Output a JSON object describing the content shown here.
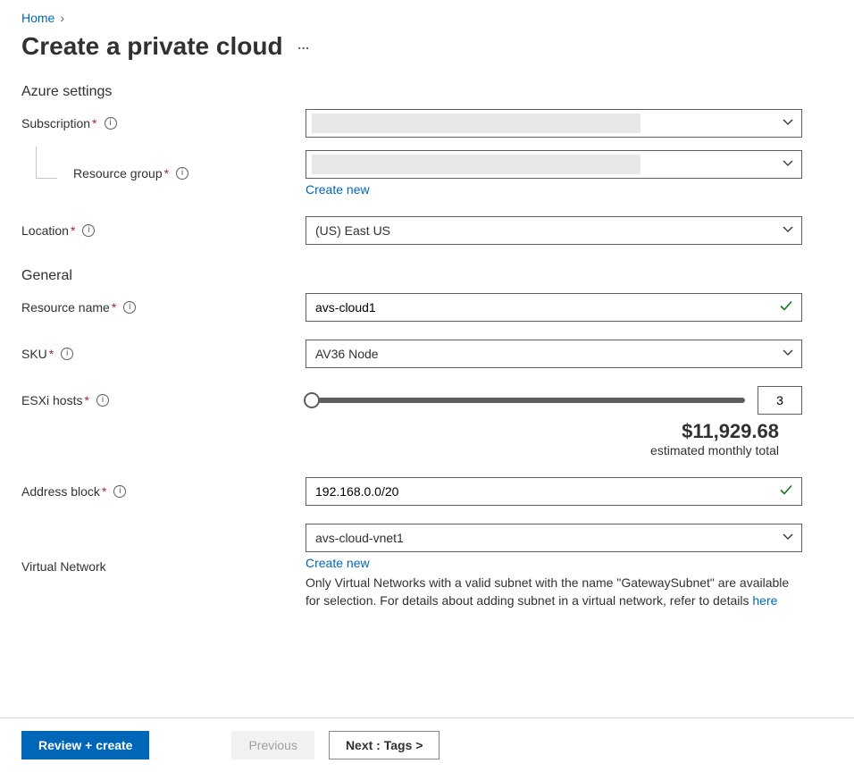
{
  "breadcrumb": {
    "home": "Home"
  },
  "title": "Create a private cloud",
  "sections": {
    "azure": "Azure settings",
    "general": "General"
  },
  "fields": {
    "subscription": {
      "label": "Subscription",
      "value": ""
    },
    "resource_group": {
      "label": "Resource group",
      "value": "",
      "create_new": "Create new"
    },
    "location": {
      "label": "Location",
      "value": "(US) East US"
    },
    "resource_name": {
      "label": "Resource name",
      "value": "avs-cloud1"
    },
    "sku": {
      "label": "SKU",
      "value": "AV36 Node"
    },
    "esxi_hosts": {
      "label": "ESXi hosts",
      "value": "3"
    },
    "price": {
      "amount": "$11,929.68",
      "sub": "estimated monthly total"
    },
    "address_block": {
      "label": "Address block",
      "value": "192.168.0.0/20"
    },
    "virtual_network": {
      "label": "Virtual Network",
      "value": "avs-cloud-vnet1",
      "create_new": "Create new",
      "help_pre": "Only Virtual Networks with a valid subnet with the name \"GatewaySubnet\" are available for selection. For details about adding subnet in a virtual network, refer to details ",
      "help_link": "here"
    }
  },
  "footer": {
    "review": "Review + create",
    "previous": "Previous",
    "next": "Next : Tags >"
  }
}
